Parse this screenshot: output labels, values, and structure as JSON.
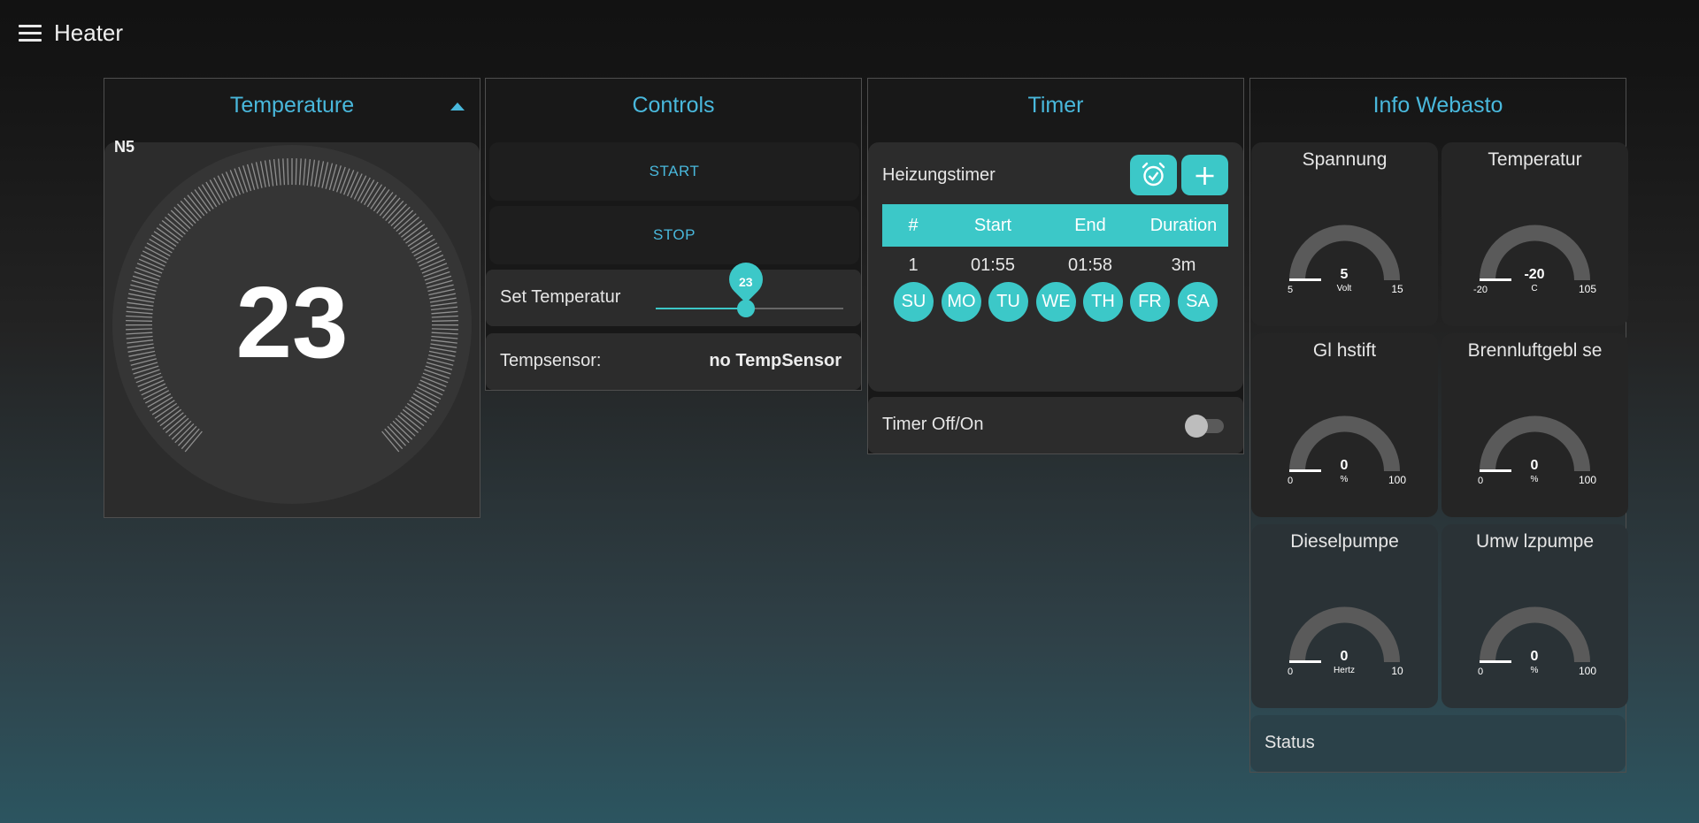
{
  "app": {
    "title": "Heater"
  },
  "temperature_card": {
    "title": "Temperature",
    "mode_label": "N5",
    "value": "23"
  },
  "controls_card": {
    "title": "Controls",
    "start_label": "START",
    "stop_label": "STOP",
    "set_temp_label": "Set Temperatur",
    "set_temp_value": "23",
    "set_temp_fraction": 0.48,
    "sensor_label": "Tempsensor:",
    "sensor_value": "no TempSensor"
  },
  "timer_card": {
    "title": "Timer",
    "timer_name": "Heizungstimer",
    "columns": [
      "#",
      "Start",
      "End",
      "Duration"
    ],
    "rows": [
      {
        "index": "1",
        "start": "01:55",
        "end": "01:58",
        "duration": "3m"
      }
    ],
    "days": [
      "SU",
      "MO",
      "TU",
      "WE",
      "TH",
      "FR",
      "SA"
    ],
    "toggle_label": "Timer Off/On",
    "toggle_on": false,
    "accent_color": "#3cc8c8"
  },
  "info_card": {
    "title": "Info Webasto",
    "gauges": [
      {
        "title": "Spannung",
        "value": "5",
        "unit": "Volt",
        "min": "5",
        "max": "15"
      },
      {
        "title": "Temperatur",
        "value": "-20",
        "unit": "C",
        "min": "-20",
        "max": "105"
      },
      {
        "title": "Gl hstift",
        "value": "0",
        "unit": "%",
        "min": "0",
        "max": "100"
      },
      {
        "title": "Brennluftgebl se",
        "value": "0",
        "unit": "%",
        "min": "0",
        "max": "100"
      },
      {
        "title": "Dieselpumpe",
        "value": "0",
        "unit": "Hertz",
        "min": "0",
        "max": "10"
      },
      {
        "title": "Umw lzpumpe",
        "value": "0",
        "unit": "%",
        "min": "0",
        "max": "100"
      }
    ],
    "status_label": "Status"
  },
  "colors": {
    "accent_blue": "#49b8dc",
    "accent_teal": "#3cc8c8"
  }
}
